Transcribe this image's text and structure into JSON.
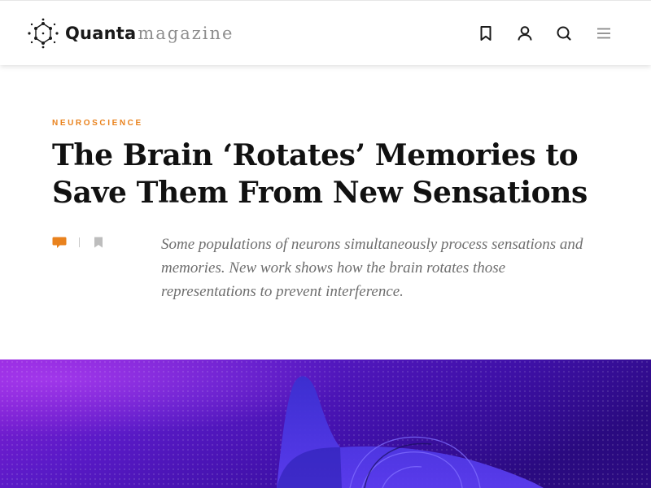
{
  "brand": {
    "name_primary": "Quanta",
    "name_secondary": "magazine",
    "logo_icon": "molecule-logo-icon"
  },
  "header": {
    "icons": [
      "bookmark-icon",
      "user-icon",
      "search-icon",
      "menu-icon"
    ]
  },
  "article": {
    "kicker": "NEUROSCIENCE",
    "title": "The Brain ‘Rotates’ Memories to Save Them From New Sensations",
    "dek": "Some populations of neurons simultaneously process sensations and memories. New work shows how the brain rotates those representations to prevent interference.",
    "tool_icons": [
      "comment-icon",
      "bookmark-icon"
    ]
  },
  "colors": {
    "accent_orange": "#e9821d",
    "hero_purple": "#4b12b8",
    "hero_magenta": "#8a1fd6",
    "text_dark": "#111111",
    "text_muted": "#6e6e6e"
  }
}
